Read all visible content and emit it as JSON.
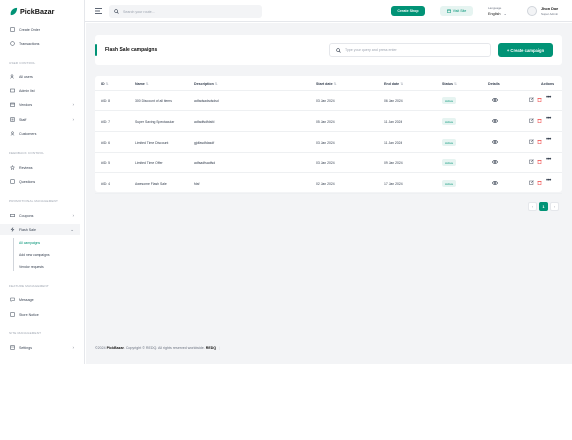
{
  "brand": "PickBazar",
  "header": {
    "search_placeholder": "Search your route...",
    "create_shop": "Create Shop",
    "visit_site": "Visit Site",
    "language_label": "Language",
    "language_value": "English",
    "user_name": "Jhon Doe",
    "user_role": "Super Admin"
  },
  "sidebar": {
    "items_top": [
      {
        "label": "Create Order"
      },
      {
        "label": "Transactions"
      }
    ],
    "section_user": "USER CONTROL",
    "items_user": [
      {
        "label": "All users"
      },
      {
        "label": "Admin list"
      },
      {
        "label": "Vendors"
      },
      {
        "label": "Staff"
      },
      {
        "label": "Customers"
      }
    ],
    "section_feedback": "FEEDBACK CONTROL",
    "items_feedback": [
      {
        "label": "Reviews"
      },
      {
        "label": "Questions"
      }
    ],
    "section_promo": "PROMOTIONAL MANAGEMENT",
    "items_promo": [
      {
        "label": "Coupons"
      },
      {
        "label": "Flash Sale"
      }
    ],
    "flash_sub": [
      {
        "label": "All campaigns"
      },
      {
        "label": "Add new campaigns"
      },
      {
        "label": "Vendor requests"
      }
    ],
    "section_feature": "FEATURE MANAGEMENT",
    "items_feature": [
      {
        "label": "Message"
      },
      {
        "label": "Store Notice"
      }
    ],
    "section_site": "SITE MANAGEMENT",
    "items_site": [
      {
        "label": "Settings"
      }
    ]
  },
  "page": {
    "title": "Flash Sale campaigns",
    "search_placeholder": "Type your query and press enter",
    "create_button": "+ Create campaign"
  },
  "table": {
    "columns": [
      "ID",
      "Name",
      "Description",
      "Start date",
      "End date",
      "Status",
      "Details",
      "Actions"
    ],
    "rows": [
      {
        "id": "#ID: 8",
        "name": "300 Discount of all items",
        "description": "adfadsadsdsdsd",
        "start": "03 Jan 2024",
        "end": "06 Jan 2024",
        "status": "Active"
      },
      {
        "id": "#ID: 7",
        "name": "Super Saving Spectacular",
        "description": "adfadfsdfdsfd",
        "start": "05 Jan 2024",
        "end": "11 Jan 2024",
        "status": "Active"
      },
      {
        "id": "#ID: 6",
        "name": "Limited Time Discount",
        "description": "gjdfasdfdasdf",
        "start": "03 Jan 2024",
        "end": "11 Jan 2024",
        "status": "Active"
      },
      {
        "id": "#ID: 5",
        "name": "Limited Time Offer",
        "description": "adfsadfsadfsd",
        "start": "03 Jan 2024",
        "end": "09 Jan 2024",
        "status": "Active"
      },
      {
        "id": "#ID: 4",
        "name": "Awesome Flash Sale",
        "description": "fdsf",
        "start": "02 Jan 2024",
        "end": "17 Jan 2024",
        "status": "Active"
      }
    ]
  },
  "pagination": {
    "prev": "‹",
    "current": "1",
    "next": "›"
  },
  "footer": {
    "prefix": "©2024 ",
    "brand": "PickBazar",
    "middle": ". Copyright © REDQ. All rights reserved worldwide. ",
    "company": "REDQ",
    "sep": "|"
  },
  "colors": {
    "accent": "#019376",
    "accent_light": "#e6f4f1",
    "danger": "#ef4444",
    "bg": "#f3f4f6"
  }
}
